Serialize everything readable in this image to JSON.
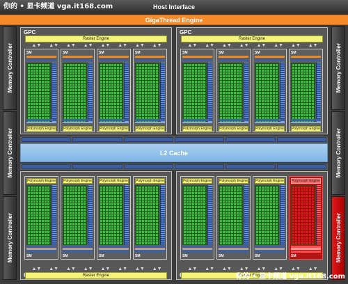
{
  "watermark": "你的 • 显卡频道 vga.it168.com",
  "host_interface": "Host Interface",
  "gigathread_engine": "GigaThread Engine",
  "memory_controller_label": "Memory Controller",
  "l2_cache": "L2 Cache",
  "gpc_label": "GPC",
  "raster_engine_label": "Raster Engine",
  "sm_label": "SM",
  "polymorph_engine_label": "Polymorph Engine",
  "highlight_color": "#e01616",
  "core_color": "#36c236",
  "cache_color": "#f08a24",
  "sfu_color": "#2f4f98",
  "mc_count": 6,
  "gpcs": [
    {
      "raster_position": "top",
      "sms": 4,
      "highlighted_sm": null
    },
    {
      "raster_position": "top",
      "sms": 4,
      "highlighted_sm": null
    },
    {
      "raster_position": "bottom",
      "sms": 4,
      "highlighted_sm": null
    },
    {
      "raster_position": "bottom",
      "sms": 4,
      "highlighted_sm": 4
    }
  ]
}
